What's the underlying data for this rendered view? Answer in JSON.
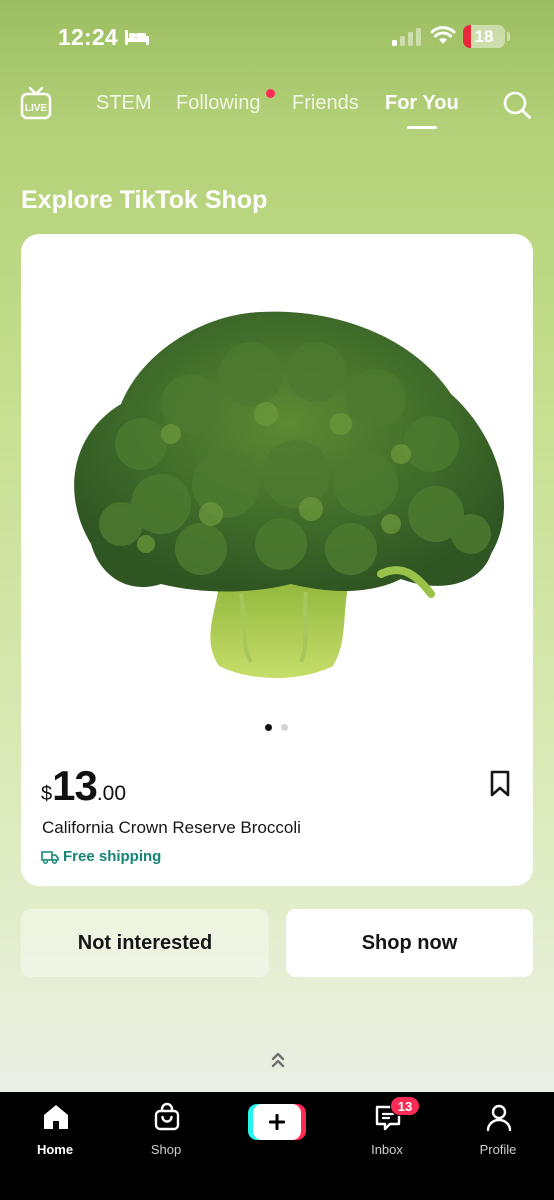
{
  "status_bar": {
    "time": "12:24",
    "battery_level": "18",
    "icons": [
      "sleep-bed-icon",
      "cellular-signal-icon",
      "wifi-icon",
      "battery-icon"
    ]
  },
  "top_nav": {
    "live_icon": "live-tv-icon",
    "tabs": [
      {
        "label": "STEM",
        "active": false
      },
      {
        "label": "Following",
        "active": false,
        "has_notification_dot": true
      },
      {
        "label": "Friends",
        "active": false
      },
      {
        "label": "For You",
        "active": true
      }
    ],
    "search_icon": "search-icon"
  },
  "section": {
    "title": "Explore TikTok Shop"
  },
  "product": {
    "image_subject": "broccoli-crown",
    "carousel_total": 2,
    "carousel_current": 1,
    "price_currency": "$",
    "price_whole": "13",
    "price_cents": ".00",
    "title": "California Crown Reserve Broccoli",
    "shipping": "Free shipping",
    "bookmark_icon": "bookmark-icon"
  },
  "actions": {
    "not_interested": "Not interested",
    "shop_now": "Shop now"
  },
  "bottom_nav": {
    "items": [
      {
        "label": "Home",
        "icon": "home-icon",
        "active": true
      },
      {
        "label": "Shop",
        "icon": "shopping-bag-icon",
        "active": false
      },
      {
        "label": "",
        "icon": "create-plus-icon",
        "active": false
      },
      {
        "label": "Inbox",
        "icon": "inbox-icon",
        "active": false,
        "badge": "13"
      },
      {
        "label": "Profile",
        "icon": "profile-icon",
        "active": false
      }
    ]
  },
  "colors": {
    "accent_red": "#fe2c55",
    "accent_cyan": "#25f4ee",
    "shipping_teal": "#168474",
    "background_green": "#b3d178"
  }
}
